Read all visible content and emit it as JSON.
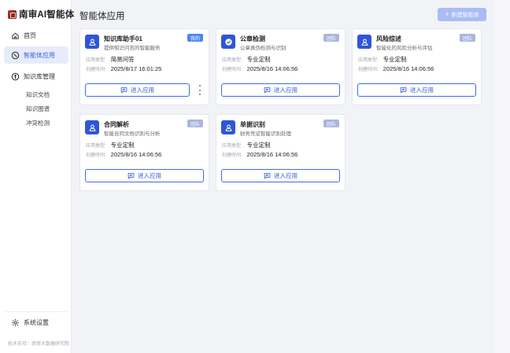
{
  "brand": {
    "name": "南审AI智能体"
  },
  "sidebar": {
    "items": [
      {
        "label": "首页",
        "icon": "home-icon"
      },
      {
        "label": "智能体应用",
        "icon": "compass-icon",
        "active": true
      },
      {
        "label": "知识库管理",
        "icon": "knowledge-icon"
      }
    ],
    "sub_items": [
      {
        "label": "知识文档"
      },
      {
        "label": "知识图谱"
      },
      {
        "label": "冲突检测"
      }
    ],
    "settings_label": "系统设置",
    "footer": "技术支持：南审大数据研究院"
  },
  "main": {
    "title": "智能体应用",
    "new_button_label": "新建智能体",
    "type_label": "应用类型:",
    "created_label": "创建时间:",
    "enter_label": "进入应用",
    "cards": [
      {
        "title": "知识库助手01",
        "desc": "提供知识问答的智能服务",
        "badge": "我的",
        "badge_kind": "mine",
        "type": "简易问答",
        "created": "2025/8/17 16:01:25",
        "icon": "user-icon",
        "has_more": true
      },
      {
        "title": "公章检测",
        "desc": "公章真伪检测与识别",
        "badge": "团队",
        "badge_kind": "team",
        "type": "专业定制",
        "created": "2025/8/16 14:06:56",
        "icon": "check-circle-icon",
        "has_more": false
      },
      {
        "title": "风险综述",
        "desc": "智能化的风险分析与评估",
        "badge": "团队",
        "badge_kind": "team",
        "type": "专业定制",
        "created": "2025/8/16 14:06:56",
        "icon": "user-icon",
        "has_more": false
      },
      {
        "title": "合同解析",
        "desc": "智能合同文档识别与分析",
        "badge": "团队",
        "badge_kind": "team",
        "type": "专业定制",
        "created": "2025/8/16 14:06:56",
        "icon": "user-icon",
        "has_more": false
      },
      {
        "title": "单据识别",
        "desc": "财务凭证智能识别处理",
        "badge": "团队",
        "badge_kind": "team",
        "type": "专业定制",
        "created": "2025/8/16 14:06:56",
        "icon": "user-icon",
        "has_more": false
      }
    ]
  },
  "colors": {
    "primary": "#2f56d6",
    "active_bg": "#e7ecfb",
    "mine_badge": "#4e86f0",
    "team_badge": "#a8b6dd",
    "new_button": "#a9bcf7"
  }
}
